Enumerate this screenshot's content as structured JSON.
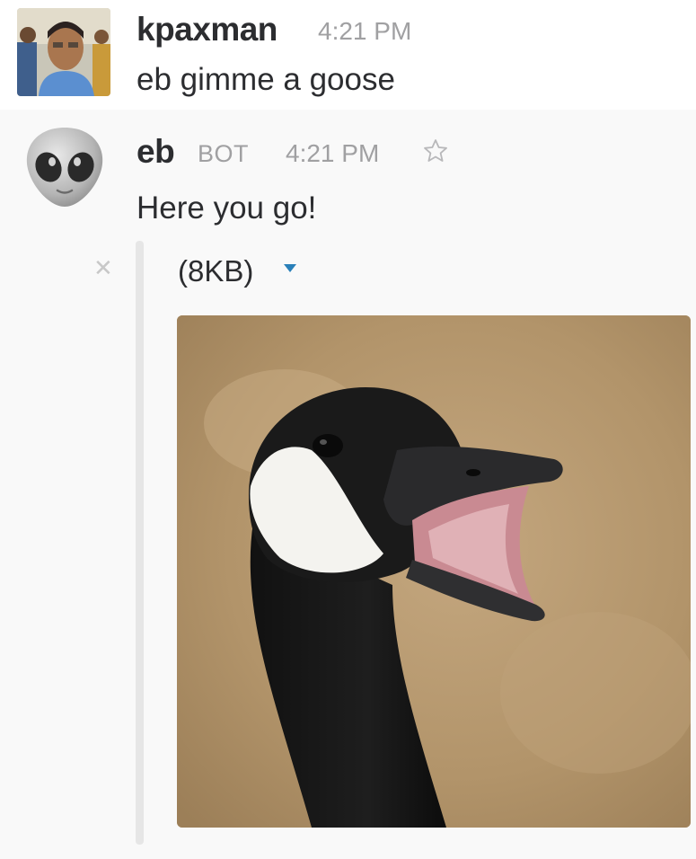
{
  "messages": [
    {
      "sender": "kpaxman",
      "time": "4:21 PM",
      "text": "eb gimme a goose",
      "avatar": "user-photo-avatar"
    },
    {
      "sender": "eb",
      "badge": "BOT",
      "time": "4:21 PM",
      "text": "Here you go!",
      "avatar": "alien-emoji-avatar",
      "attachment": {
        "size": "(8KB)",
        "image": "goose-photo"
      }
    }
  ],
  "colors": {
    "text": "#2c2d30",
    "muted": "#a0a0a2",
    "link_blue": "#2a80b9",
    "hover_bg": "#f9f9f9"
  }
}
